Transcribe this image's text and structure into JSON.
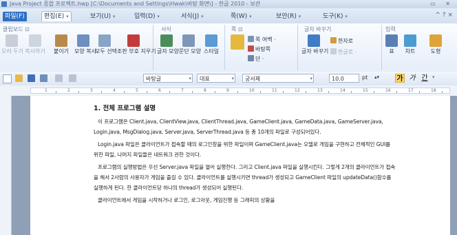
{
  "window": {
    "title": "Java Project 종합 프로젝트.hwp [C:\\Documents and Settings\\Hwak\\바탕 화면\\] - 한글 2010 - 보관"
  },
  "menu": {
    "file": "파일(F)",
    "items": [
      "편집(E)",
      "보기(U)",
      "입력(D)",
      "서식(J)",
      "쪽(W)",
      "보안(R)",
      "도구(K)"
    ],
    "right_ctrl": "^ ? ×"
  },
  "ribbon": {
    "groups": [
      {
        "label": "클립보드 ⊡"
      },
      {
        "label": "서식"
      },
      {
        "label": "쪽 ⊡"
      },
      {
        "label": "글자 바꾸기"
      },
      {
        "label": "입력"
      }
    ],
    "clipboard_buttons": [
      "오려 두기",
      "복사하기",
      "붙이기",
      "모양 복사",
      "모두 선택",
      "조판 부호 지우기"
    ],
    "format_buttons": [
      "글자 모양",
      "문단 모양",
      "스타일"
    ],
    "page_small": [
      "쪽 여백 ·",
      "바탕쪽",
      "단 ·"
    ],
    "char_buttons": [
      "글자 바꾸기 ·"
    ],
    "char_small": [
      "한자로",
      "한글로 ·"
    ],
    "insert_buttons": [
      "표",
      "차트",
      "도형"
    ]
  },
  "toolbar": {
    "style": "바탕글",
    "lang": "대표",
    "font": "궁서체",
    "size": "10.0",
    "unit": "pt",
    "bold": "가",
    "italic": "가",
    "underline": "간"
  },
  "ruler": {
    "numbers": [
      "1",
      "2",
      "3",
      "4",
      "5",
      "6",
      "7",
      "8",
      "9",
      "10",
      "11",
      "12",
      "13",
      "14",
      "15",
      "16",
      "17",
      "18"
    ]
  },
  "document": {
    "heading": "1. 전체 프로그램 설명",
    "paragraphs": [
      "이 프로그램은 Client.java, ClientView.java, ClientThread.java, GameClient.java, GameData.java, GameServer.java, Login.java, MsgDialog.java, Server.java, ServerThread.java 등 총 10개의 파일로 구성되어있다.",
      "Login.java 파일은 클라이언트가 접속할 때의 로그인창을 위한 파일이며 GameClient.java는 오델로 게임을 구현하고 전체적인 GUI를 위한 파일, 나머지 파일들은 네트워크 관한 것이다.",
      "프로그램의 실행방법은 우선 Server.java 파일을 열어 실행한다. 그리고 Client.java 파일을 실행시킨다. 그렇게 2개의 클라이언트가 접속을 해서 2사람의 사용자가 게임을 즐길 수 있다. 클라이언트를 실행시키면 thread가 생성되고 GameClient 파일의 updateData()함수를 실행하게 된다. 한 클라이언트당 하나의 thread가 생성되어 실행된다.",
      "클라이언트에서 게임을 시작하거나 로그인, 로그아웃, 게임진행 등 그래피의 상황을"
    ]
  },
  "colors": {
    "file_menu": "#2f6fc1",
    "ribbon_bg": "#e6eef9",
    "workspace": "#8e9fb6",
    "bold_highlight": "#f7d46a"
  }
}
